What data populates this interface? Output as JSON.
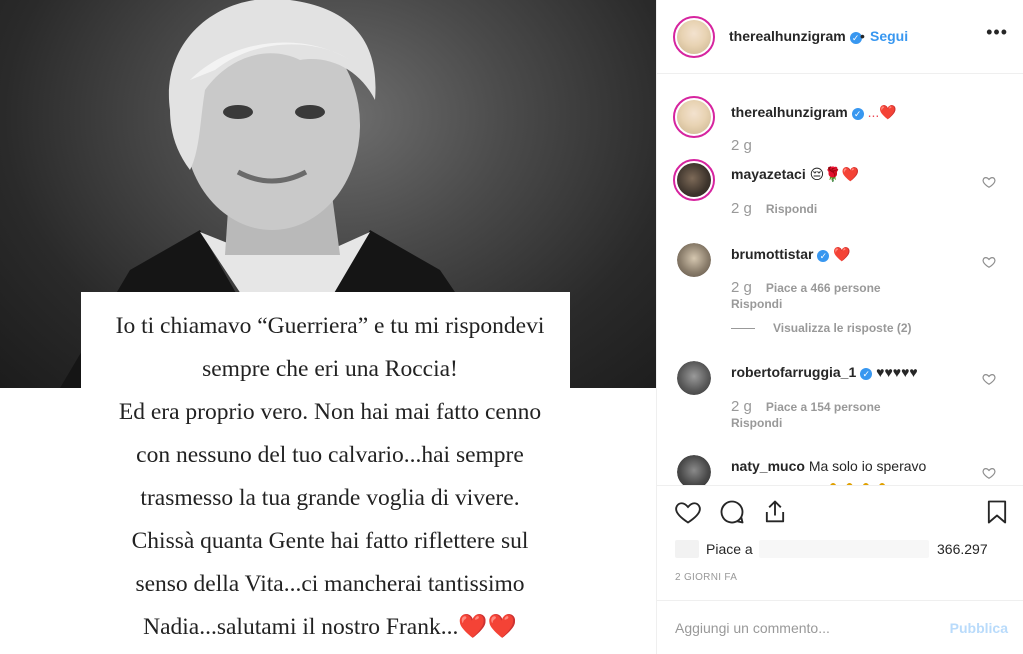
{
  "post": {
    "quote_lines": [
      "Io ti chiamavo “Guerriera” e tu mi rispondevi",
      "sempre che eri una Roccia!",
      "Ed era proprio vero. Non hai mai fatto cenno",
      "con nessuno del tuo calvario...hai sempre",
      "trasmesso la tua grande voglia di vivere.",
      "Chissà quanta Gente hai fatto riflettere sul",
      "senso della Vita...ci mancherai tantissimo",
      "Nadia...salutami il nostro Frank..."
    ],
    "quote_hearts": "❤️❤️"
  },
  "header": {
    "username": "therealhunzigram",
    "verified_mark": "✓",
    "separator": "•",
    "follow_label": "Segui",
    "more_label": "•••"
  },
  "comments": [
    {
      "username": "therealhunzigram",
      "text": "...❤️",
      "age": "2 g",
      "reply_label": "",
      "likes_label": ""
    },
    {
      "username": "mayazetaci",
      "text": "😔🌹❤️",
      "age": "2 g",
      "reply_label": "Rispondi",
      "likes_label": ""
    },
    {
      "username": "brumottistar",
      "text": "❤️",
      "age": "2 g",
      "likes_label": "Piace a 466 persone",
      "reply_label": "Rispondi",
      "view_replies": "Visualizza le risposte (2)"
    },
    {
      "username": "robertofarruggia_1",
      "text": "♥♥♥♥♥",
      "age": "2 g",
      "likes_label": "Piace a 154 persone",
      "reply_label": "Rispondi"
    },
    {
      "username": "naty_muco",
      "text": "Ma solo io speravo"
    }
  ],
  "actions": {
    "likes_prefix": "Piace a",
    "likes_count": "366.297",
    "date": "2 GIORNI FA"
  },
  "composer": {
    "placeholder": "Aggiungi un commento...",
    "publish_label": "Pubblica"
  },
  "icons": [
    "heart-icon",
    "comment-icon",
    "share-icon",
    "bookmark-icon",
    "more-icon",
    "verified-icon"
  ],
  "colors": {
    "link_blue": "#3897f0",
    "verified_blue": "#3897f0",
    "heart_red": "#ed4956",
    "publish_disabled": "#b9dbfb"
  }
}
